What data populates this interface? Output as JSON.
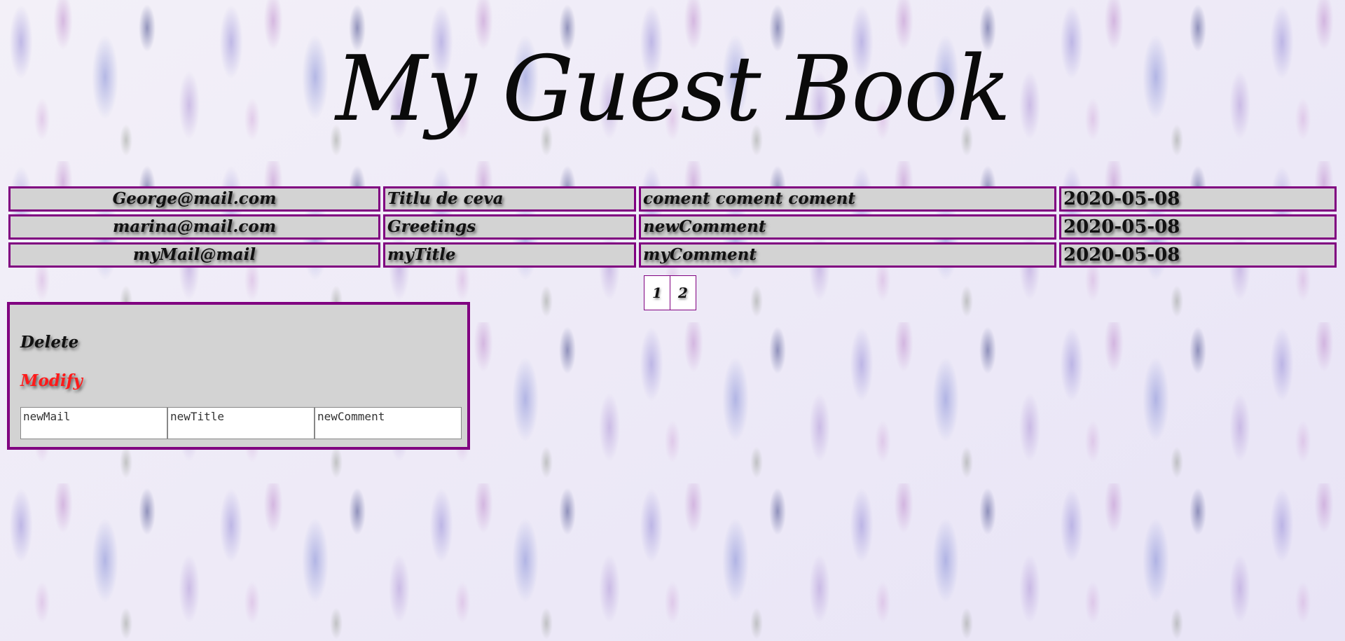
{
  "header": {
    "title": "My Guest Book"
  },
  "entries": [
    {
      "mail": "George@mail.com",
      "title": "Titlu de ceva",
      "comment": "coment coment coment",
      "date": "2020-05-08"
    },
    {
      "mail": "marina@mail.com",
      "title": "Greetings",
      "comment": "newComment",
      "date": "2020-05-08"
    },
    {
      "mail": "myMail@mail",
      "title": "myTitle",
      "comment": "myComment",
      "date": "2020-05-08"
    }
  ],
  "pagination": {
    "pages": [
      "1",
      "2"
    ]
  },
  "panel": {
    "delete_label": "Delete",
    "modify_label": "Modify",
    "fields": {
      "mail_placeholder": "newMail",
      "title_placeholder": "newTitle",
      "comment_placeholder": "newComment"
    }
  },
  "colors": {
    "border": "#800080",
    "cell_bg": "#d3d3d3",
    "modify": "#ff1a1a"
  }
}
